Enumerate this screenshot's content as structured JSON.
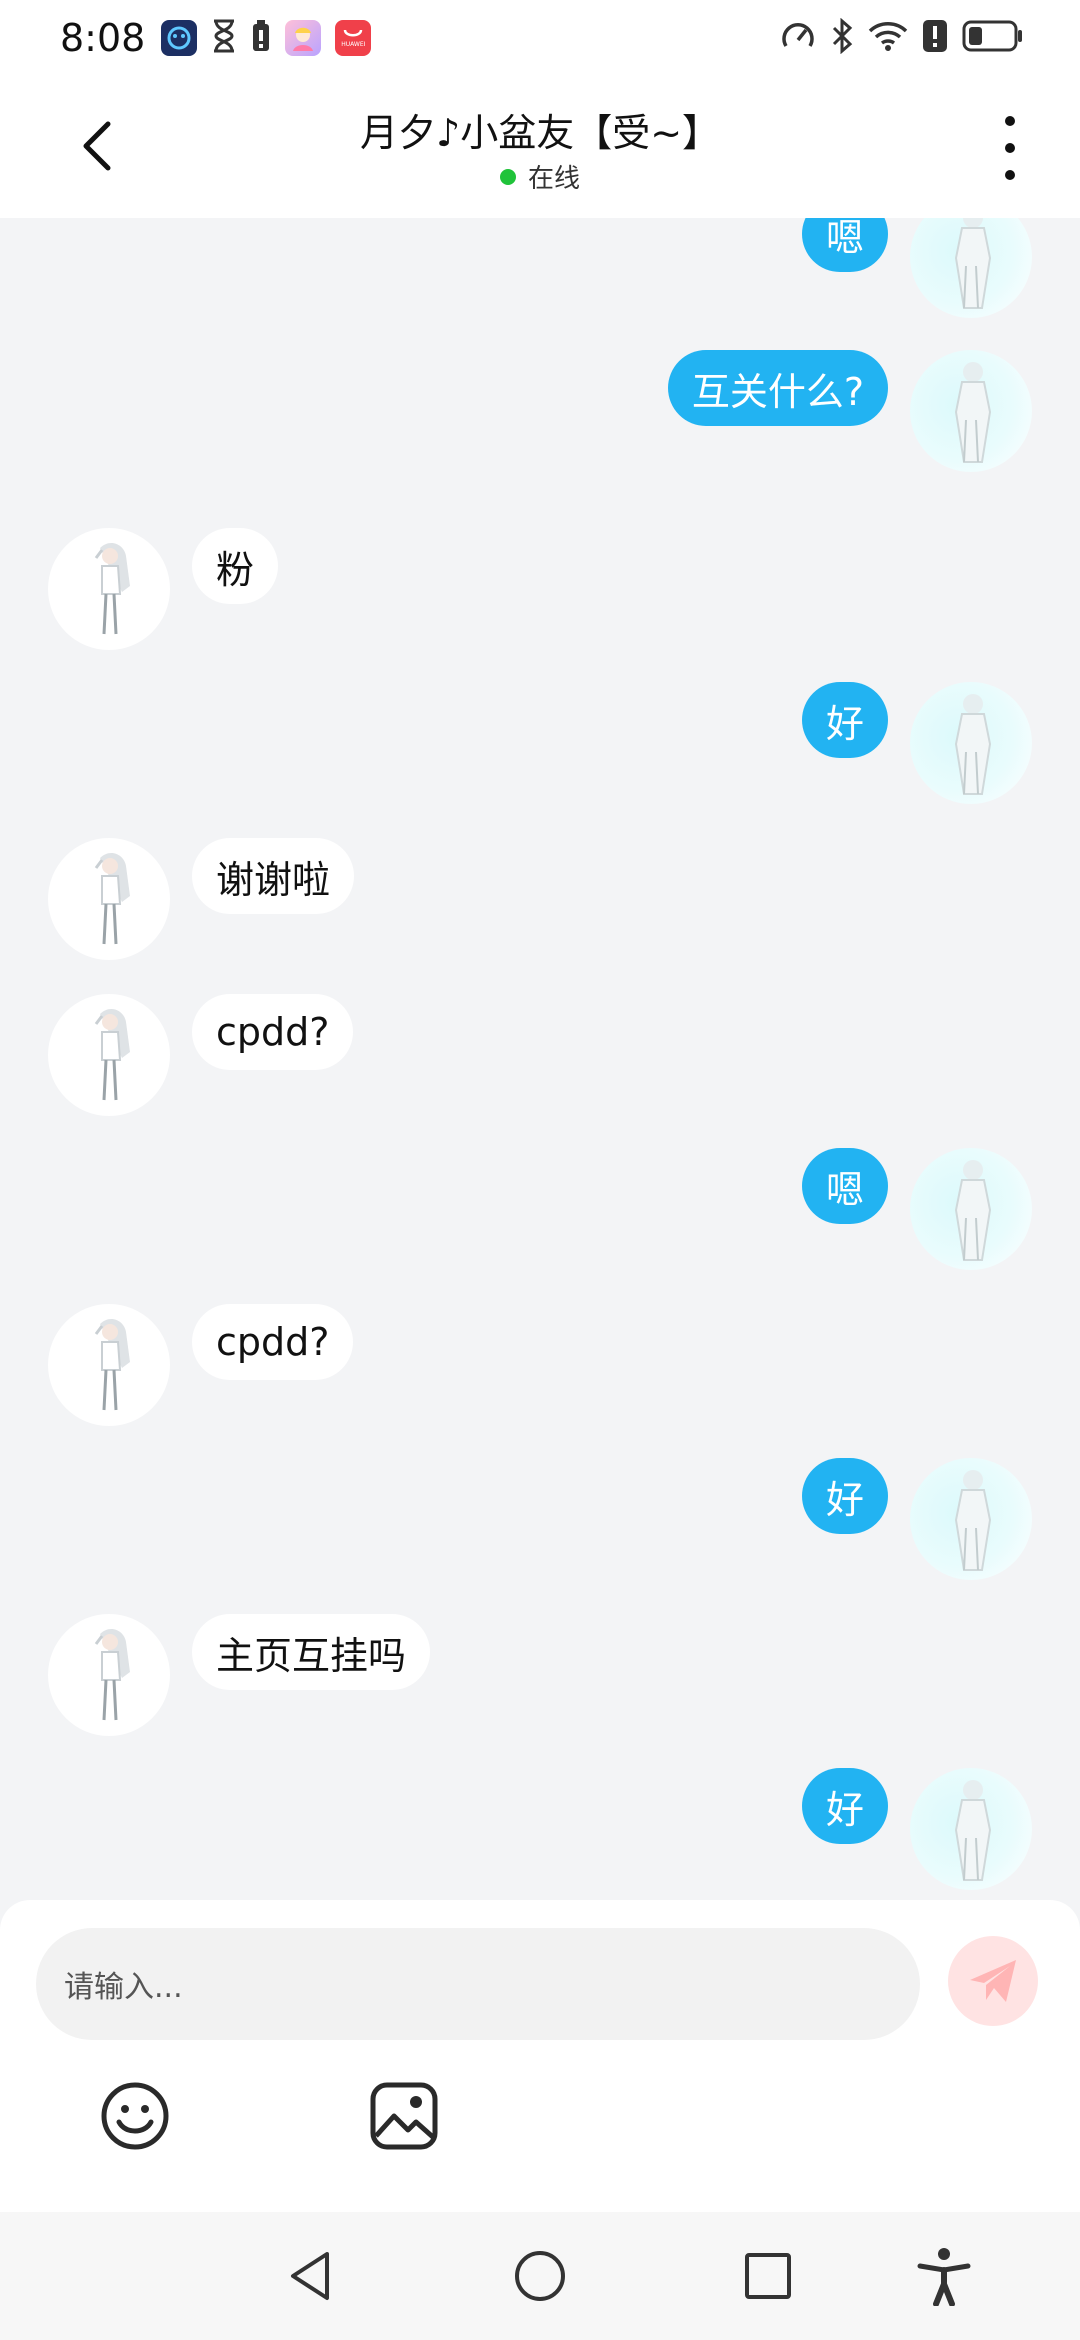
{
  "status_bar": {
    "time": "8:08",
    "left_icons": [
      "app-icon-blue",
      "hourglass-icon",
      "battery-small-icon",
      "anime-app-icon",
      "huawei-store-icon"
    ],
    "huawei_label": "HUAWEI",
    "right_icons": [
      "speedometer-icon",
      "bluetooth-icon",
      "wifi-icon",
      "alert-icon",
      "battery-icon"
    ]
  },
  "header": {
    "title": "月夕♪小盆友【受~】",
    "status": "在线",
    "status_color": "#20c33a"
  },
  "messages": [
    {
      "side": "sent",
      "text": "嗯"
    },
    {
      "side": "sent",
      "text": "互关什么?"
    },
    {
      "side": "recv",
      "text": "粉"
    },
    {
      "side": "sent",
      "text": "好"
    },
    {
      "side": "recv",
      "text": "谢谢啦"
    },
    {
      "side": "recv",
      "text": "cpdd?"
    },
    {
      "side": "sent",
      "text": "嗯"
    },
    {
      "side": "recv",
      "text": "cpdd?"
    },
    {
      "side": "sent",
      "text": "好"
    },
    {
      "side": "recv",
      "text": "主页互挂吗"
    },
    {
      "side": "sent",
      "text": "好"
    }
  ],
  "input": {
    "placeholder": "请输入..."
  },
  "colors": {
    "sent_bubble": "#22b3f2",
    "recv_bubble": "#ffffff",
    "background": "#f3f4f6",
    "send_button": "#ffe3e3"
  },
  "toolbar": [
    "emoji-icon",
    "image-icon"
  ],
  "nav": [
    "back-triangle-icon",
    "home-circle-icon",
    "recents-square-icon",
    "accessibility-icon"
  ]
}
